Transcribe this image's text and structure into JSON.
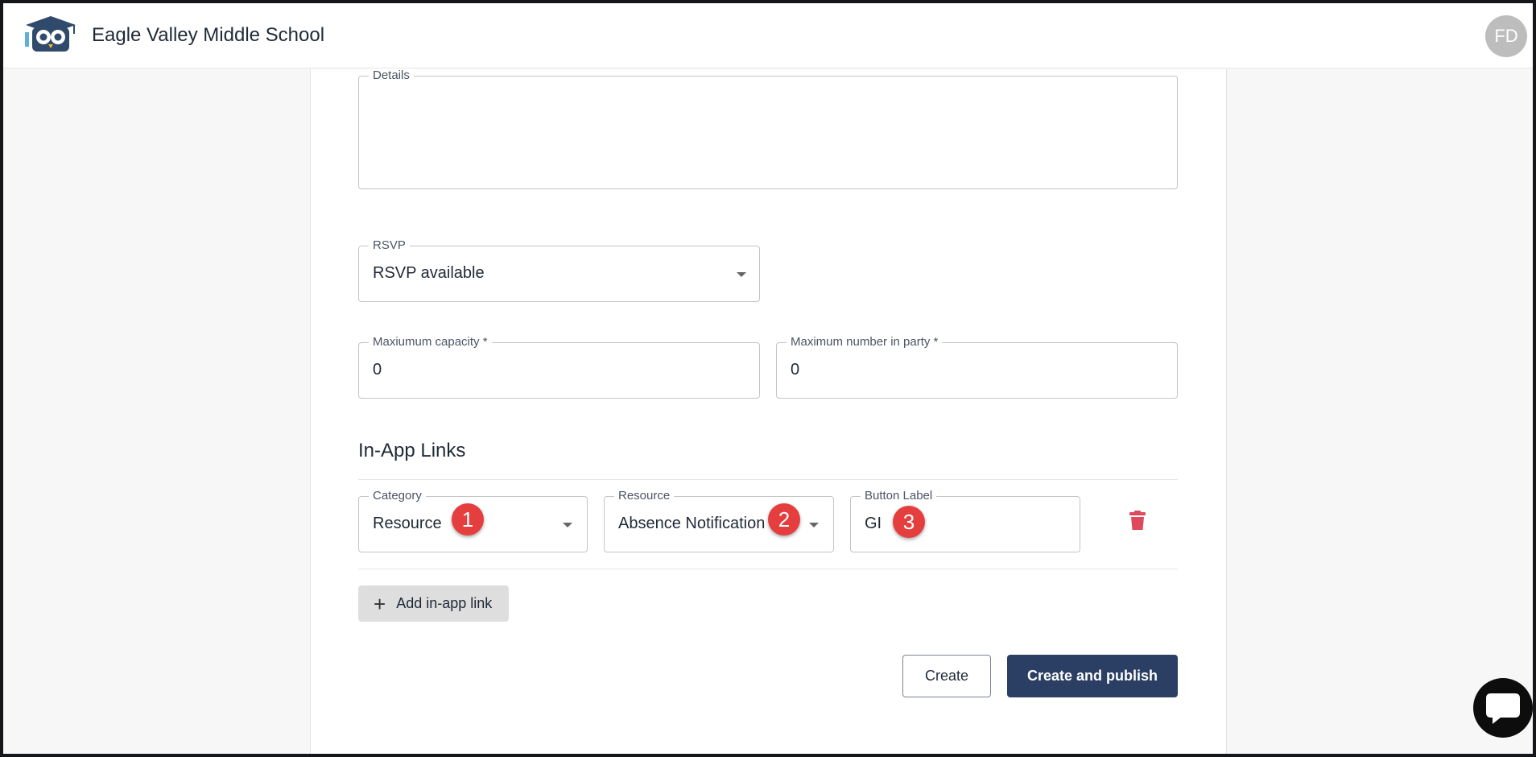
{
  "app": {
    "school_name": "Eagle Valley Middle School",
    "avatar_initials": "FD"
  },
  "form": {
    "details": {
      "label": "Details",
      "value": ""
    },
    "rsvp": {
      "label": "RSVP",
      "value": "RSVP available"
    },
    "max_capacity": {
      "label": "Maxiumum capacity *",
      "value": "0"
    },
    "max_party": {
      "label": "Maximum number in party *",
      "value": "0"
    }
  },
  "in_app_links": {
    "title": "In-App Links",
    "category": {
      "label": "Category",
      "value": "Resource"
    },
    "resource": {
      "label": "Resource",
      "value": "Absence Notification"
    },
    "button_label": {
      "label": "Button Label",
      "value": "GI"
    },
    "add_label": "Add in-app link"
  },
  "markers": [
    "1",
    "2",
    "3"
  ],
  "actions": {
    "create_label": "Create",
    "publish_label": "Create and publish"
  },
  "colors": {
    "primary": "#2b3e63",
    "delete": "#e0495b",
    "marker": "#e53e3e"
  }
}
